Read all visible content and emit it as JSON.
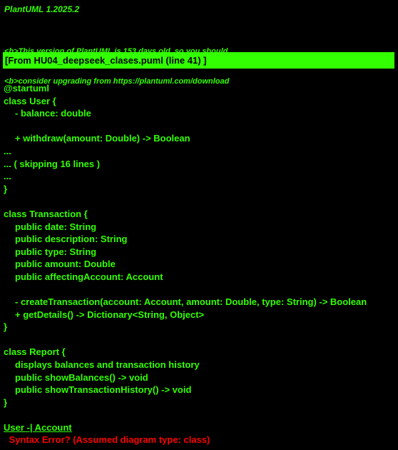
{
  "header": {
    "version": "PlantUML 1.2025.2",
    "notice_line_1": "<b>This version of PlantUML is 153 days old, so you should",
    "notice_line_2": "<b>consider upgrading from https://plantuml.com/download"
  },
  "source_banner": "[From HU04_deepseek_clases.puml (line 41) ]",
  "code_lines": [
    {
      "text": "@startuml",
      "indent": false
    },
    {
      "text": "class User {",
      "indent": false
    },
    {
      "text": "- balance: double",
      "indent": true
    },
    {
      "text": "",
      "indent": false
    },
    {
      "text": "+ withdraw(amount: Double) -> Boolean",
      "indent": true
    },
    {
      "text": "...",
      "indent": false
    },
    {
      "text": "... ( skipping 16 lines )",
      "indent": false
    },
    {
      "text": "...",
      "indent": false
    },
    {
      "text": "}",
      "indent": false
    },
    {
      "text": "",
      "indent": false
    },
    {
      "text": "class Transaction {",
      "indent": false
    },
    {
      "text": "public date: String",
      "indent": true
    },
    {
      "text": "public description: String",
      "indent": true
    },
    {
      "text": "public type: String",
      "indent": true
    },
    {
      "text": "public amount: Double",
      "indent": true
    },
    {
      "text": "public affectingAccount: Account",
      "indent": true
    },
    {
      "text": "",
      "indent": false
    },
    {
      "text": "- createTransaction(account: Account, amount: Double, type: String) -> Boolean",
      "indent": true
    },
    {
      "text": "+ getDetails() -> Dictionary<String, Object>",
      "indent": true
    },
    {
      "text": "}",
      "indent": false
    },
    {
      "text": "",
      "indent": false
    },
    {
      "text": "class Report {",
      "indent": false
    },
    {
      "text": "displays balances and transaction history",
      "indent": true
    },
    {
      "text": "public showBalances() -> void",
      "indent": true
    },
    {
      "text": "public showTransactionHistory() -> void",
      "indent": true
    },
    {
      "text": "}",
      "indent": false
    },
    {
      "text": "",
      "indent": false
    }
  ],
  "error_line": "User -| Account",
  "syntax_error": " Syntax Error? (Assumed diagram type: class)",
  "colors": {
    "background": "#000000",
    "text": "#33FF02",
    "banner_background": "#33FF02",
    "banner_text": "#000000",
    "error": "#FF0000"
  }
}
